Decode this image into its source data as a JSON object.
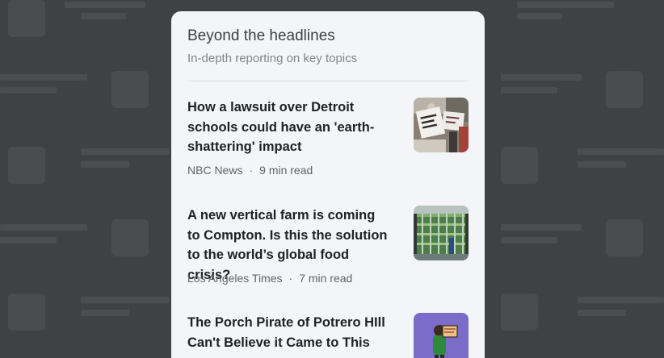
{
  "section": {
    "title": "Beyond the headlines",
    "subtitle": "In-depth reporting on key topics"
  },
  "articles": [
    {
      "headline": "How a lawsuit over Detroit schools could have an 'earth-shattering' impact",
      "source": "NBC News",
      "separator": "·",
      "read_time": "9 min read",
      "thumbnail": "protest-photo-icon"
    },
    {
      "headline": "A new vertical farm is coming to Compton. Is this the solution to the world’s global food crisis?",
      "source": "Los Angeles Times",
      "separator": "·",
      "read_time": "7 min read",
      "thumbnail": "vertical-farm-photo-icon"
    },
    {
      "headline": "The Porch Pirate of Potrero HIll Can't Believe it Came to This",
      "thumbnail": "porch-pirate-illustration-icon"
    }
  ]
}
